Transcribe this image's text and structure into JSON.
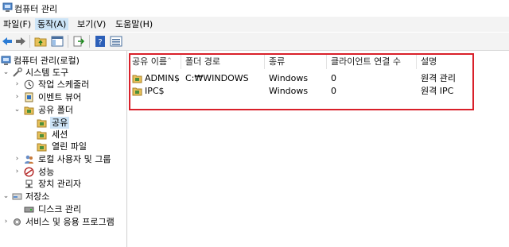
{
  "window": {
    "title": "컴퓨터 관리"
  },
  "menu": [
    {
      "label": "파일(F)",
      "active": false
    },
    {
      "label": "동작(A)",
      "active": true
    },
    {
      "label": "보기(V)",
      "active": false
    },
    {
      "label": "도움말(H)",
      "active": false
    }
  ],
  "toolbar": {
    "buttons": [
      "back-icon",
      "forward-icon",
      "up-folder-icon",
      "show-hide-tree-icon",
      "export-list-icon",
      "help-icon",
      "view-icon"
    ]
  },
  "tree": {
    "root": "컴퓨터 관리(로컬)",
    "items": [
      {
        "label": "시스템 도구"
      },
      {
        "label": "작업 스케줄러"
      },
      {
        "label": "이벤트 뷰어"
      },
      {
        "label": "공유 폴더"
      },
      {
        "label": "공유"
      },
      {
        "label": "세션"
      },
      {
        "label": "열린 파일"
      },
      {
        "label": "로컬 사용자 및 그룹"
      },
      {
        "label": "성능"
      },
      {
        "label": "장치 관리자"
      },
      {
        "label": "저장소"
      },
      {
        "label": "디스크 관리"
      },
      {
        "label": "서비스 및 응용 프로그램"
      }
    ]
  },
  "list": {
    "columns": [
      "공유 이름",
      "폴더 경로",
      "종류",
      "클라이언트 연결 수",
      "설명"
    ],
    "rows": [
      {
        "name": "ADMIN$",
        "path": "C:₩WINDOWS",
        "type": "Windows",
        "connections": "0",
        "description": "원격 관리"
      },
      {
        "name": "IPC$",
        "path": "",
        "type": "Windows",
        "connections": "0",
        "description": "원격 IPC"
      }
    ]
  },
  "colors": {
    "highlight": "#d9202a",
    "selection": "#cde3f6",
    "menu_active": "#cce4f7"
  }
}
